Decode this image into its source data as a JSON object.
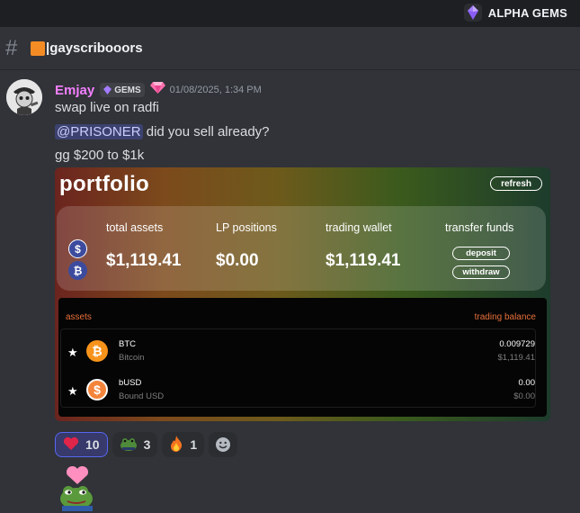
{
  "server": {
    "name": "ALPHA GEMS",
    "icon": "purple-gem-icon"
  },
  "channel": {
    "icon": "hash-icon",
    "name": "|gayscribooors",
    "prefix_color": "#f48c25"
  },
  "message": {
    "username": "Emjay",
    "username_color": "#f47fff",
    "tag": "GEMS",
    "timestamp": "01/08/2025, 1:34 PM",
    "lines": [
      "swap live on radfi",
      "did you sell already?",
      "gg $200 to $1k"
    ],
    "mention": "@PRISONER"
  },
  "embed": {
    "title": "portfolio",
    "refresh_label": "refresh",
    "summary": {
      "total_assets_label": "total assets",
      "total_assets_value": "$1,119.41",
      "lp_label": "LP positions",
      "lp_value": "$0.00",
      "wallet_label": "trading wallet",
      "wallet_value": "$1,119.41",
      "transfer_label": "transfer funds",
      "deposit_label": "deposit",
      "withdraw_label": "withdraw"
    },
    "assets": {
      "header_left": "assets",
      "header_right": "trading balance",
      "header_color": "#e8703a",
      "rows": [
        {
          "star": "★",
          "symbol": "BTC",
          "name": "Bitcoin",
          "amount": "0.009729",
          "usd": "$1,119.41",
          "icon": "bitcoin-icon"
        },
        {
          "star": "★",
          "symbol": "bUSD",
          "name": "Bound USD",
          "amount": "0.00",
          "usd": "$0.00",
          "icon": "dollar-coin-icon"
        }
      ]
    }
  },
  "reactions": [
    {
      "emoji": "❤️",
      "count": "10",
      "active": true
    },
    {
      "emoji": "🐸",
      "count": "3",
      "active": false
    },
    {
      "emoji": "🔥",
      "count": "1",
      "active": false
    }
  ],
  "sticker": "pepe-heart-sticker"
}
